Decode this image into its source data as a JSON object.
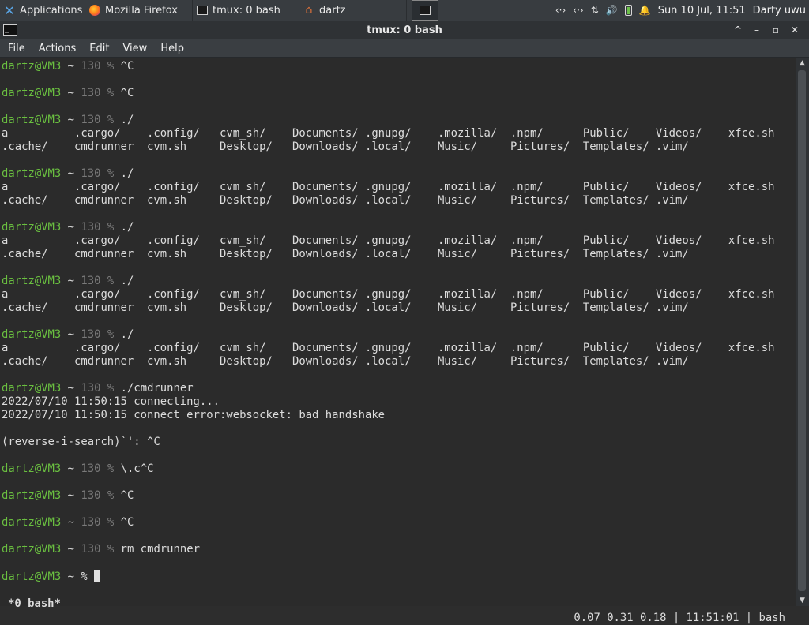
{
  "panel": {
    "applications_label": "Applications",
    "tasks": [
      {
        "label": "Mozilla Firefox",
        "icon": "firefox-icon"
      },
      {
        "label": "tmux: 0 bash",
        "icon": "terminal-icon"
      },
      {
        "label": "dartz",
        "icon": "home-folder-icon"
      }
    ],
    "clock": "Sun 10 Jul, 11:51",
    "user": "Darty uwu"
  },
  "window": {
    "title": "tmux: 0 bash",
    "terminal_icon_text": ">_"
  },
  "menu": [
    "File",
    "Actions",
    "Edit",
    "View",
    "Help"
  ],
  "prompt": {
    "user_host": "dartz@VM3",
    "path": "~",
    "exit_code": "130",
    "symbol": "%"
  },
  "terminal": {
    "lines": [
      {
        "type": "prompt",
        "code": "130",
        "cmd": "^C"
      },
      {
        "type": "blank"
      },
      {
        "type": "prompt",
        "code": "130",
        "cmd": "^C"
      },
      {
        "type": "blank"
      },
      {
        "type": "prompt",
        "code": "130",
        "cmd": "./"
      },
      {
        "type": "text",
        "text": "a          .cargo/    .config/   cvm_sh/    Documents/ .gnupg/    .mozilla/  .npm/      Public/    Videos/    xfce.sh"
      },
      {
        "type": "text",
        "text": ".cache/    cmdrunner  cvm.sh     Desktop/   Downloads/ .local/    Music/     Pictures/  Templates/ .vim/"
      },
      {
        "type": "blank"
      },
      {
        "type": "prompt",
        "code": "130",
        "cmd": "./"
      },
      {
        "type": "text",
        "text": "a          .cargo/    .config/   cvm_sh/    Documents/ .gnupg/    .mozilla/  .npm/      Public/    Videos/    xfce.sh"
      },
      {
        "type": "text",
        "text": ".cache/    cmdrunner  cvm.sh     Desktop/   Downloads/ .local/    Music/     Pictures/  Templates/ .vim/"
      },
      {
        "type": "blank"
      },
      {
        "type": "prompt",
        "code": "130",
        "cmd": "./"
      },
      {
        "type": "text",
        "text": "a          .cargo/    .config/   cvm_sh/    Documents/ .gnupg/    .mozilla/  .npm/      Public/    Videos/    xfce.sh"
      },
      {
        "type": "text",
        "text": ".cache/    cmdrunner  cvm.sh     Desktop/   Downloads/ .local/    Music/     Pictures/  Templates/ .vim/"
      },
      {
        "type": "blank"
      },
      {
        "type": "prompt",
        "code": "130",
        "cmd": "./"
      },
      {
        "type": "text",
        "text": "a          .cargo/    .config/   cvm_sh/    Documents/ .gnupg/    .mozilla/  .npm/      Public/    Videos/    xfce.sh"
      },
      {
        "type": "text",
        "text": ".cache/    cmdrunner  cvm.sh     Desktop/   Downloads/ .local/    Music/     Pictures/  Templates/ .vim/"
      },
      {
        "type": "blank"
      },
      {
        "type": "prompt",
        "code": "130",
        "cmd": "./"
      },
      {
        "type": "text",
        "text": "a          .cargo/    .config/   cvm_sh/    Documents/ .gnupg/    .mozilla/  .npm/      Public/    Videos/    xfce.sh"
      },
      {
        "type": "text",
        "text": ".cache/    cmdrunner  cvm.sh     Desktop/   Downloads/ .local/    Music/     Pictures/  Templates/ .vim/"
      },
      {
        "type": "blank"
      },
      {
        "type": "prompt",
        "code": "130",
        "cmd": "./cmdrunner"
      },
      {
        "type": "text",
        "text": "2022/07/10 11:50:15 connecting..."
      },
      {
        "type": "text",
        "text": "2022/07/10 11:50:15 connect error:websocket: bad handshake"
      },
      {
        "type": "blank"
      },
      {
        "type": "text",
        "text": "(reverse-i-search)`': ^C"
      },
      {
        "type": "blank"
      },
      {
        "type": "prompt",
        "code": "130",
        "cmd": "\\.c^C"
      },
      {
        "type": "blank"
      },
      {
        "type": "prompt",
        "code": "130",
        "cmd": "^C"
      },
      {
        "type": "blank"
      },
      {
        "type": "prompt",
        "code": "130",
        "cmd": "^C"
      },
      {
        "type": "blank"
      },
      {
        "type": "prompt",
        "code": "130",
        "cmd": "rm cmdrunner"
      },
      {
        "type": "blank"
      },
      {
        "type": "prompt",
        "code": "",
        "cmd": "",
        "cursor": true
      }
    ]
  },
  "status": {
    "window_label": "*0 bash*",
    "right": "0.07 0.31 0.18 | 11:51:01 | bash"
  },
  "colors": {
    "prompt_user": "#6abf40",
    "exit_code": "#7a7a7a",
    "terminal_bg": "#2b2b2b"
  }
}
